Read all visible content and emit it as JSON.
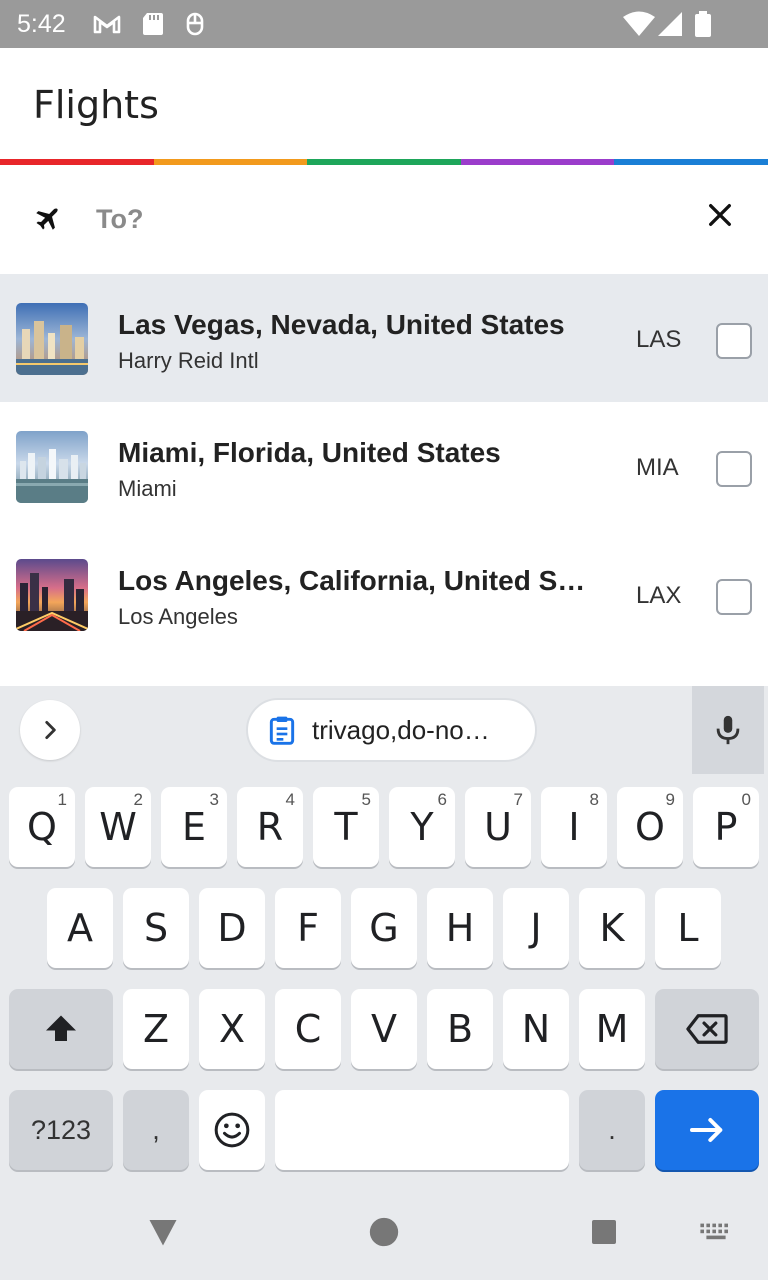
{
  "status_bar": {
    "time": "5:42",
    "icons": [
      "gmail-icon",
      "sd-card-icon",
      "debug-icon",
      "wifi-icon",
      "signal-icon",
      "battery-icon"
    ]
  },
  "header": {
    "title": "Flights",
    "stripe_colors": [
      "#e8262a",
      "#f29a1d",
      "#1ea65a",
      "#9b3ccb",
      "#1a7fd6"
    ]
  },
  "search": {
    "placeholder": "To?",
    "value": ""
  },
  "results": [
    {
      "city": "Las Vegas, Nevada, United States",
      "airport": "Harry Reid Intl",
      "code": "LAS",
      "checked": false,
      "highlighted": true
    },
    {
      "city": "Miami, Florida, United States",
      "airport": "Miami",
      "code": "MIA",
      "checked": false,
      "highlighted": false
    },
    {
      "city": "Los Angeles, California, United S…",
      "airport": "Los Angeles",
      "code": "LAX",
      "checked": false,
      "highlighted": false
    }
  ],
  "keyboard": {
    "clipboard_suggestion": "trivago,do-no…",
    "row1": [
      {
        "label": "Q",
        "hint": "1"
      },
      {
        "label": "W",
        "hint": "2"
      },
      {
        "label": "E",
        "hint": "3"
      },
      {
        "label": "R",
        "hint": "4"
      },
      {
        "label": "T",
        "hint": "5"
      },
      {
        "label": "Y",
        "hint": "6"
      },
      {
        "label": "U",
        "hint": "7"
      },
      {
        "label": "I",
        "hint": "8"
      },
      {
        "label": "O",
        "hint": "9"
      },
      {
        "label": "P",
        "hint": "0"
      }
    ],
    "row2": [
      "A",
      "S",
      "D",
      "F",
      "G",
      "H",
      "J",
      "K",
      "L"
    ],
    "row3": [
      "Z",
      "X",
      "C",
      "V",
      "B",
      "N",
      "M"
    ],
    "symbols_label": "?123",
    "comma_label": ",",
    "period_label": ".",
    "accent_color": "#1a73e8"
  }
}
